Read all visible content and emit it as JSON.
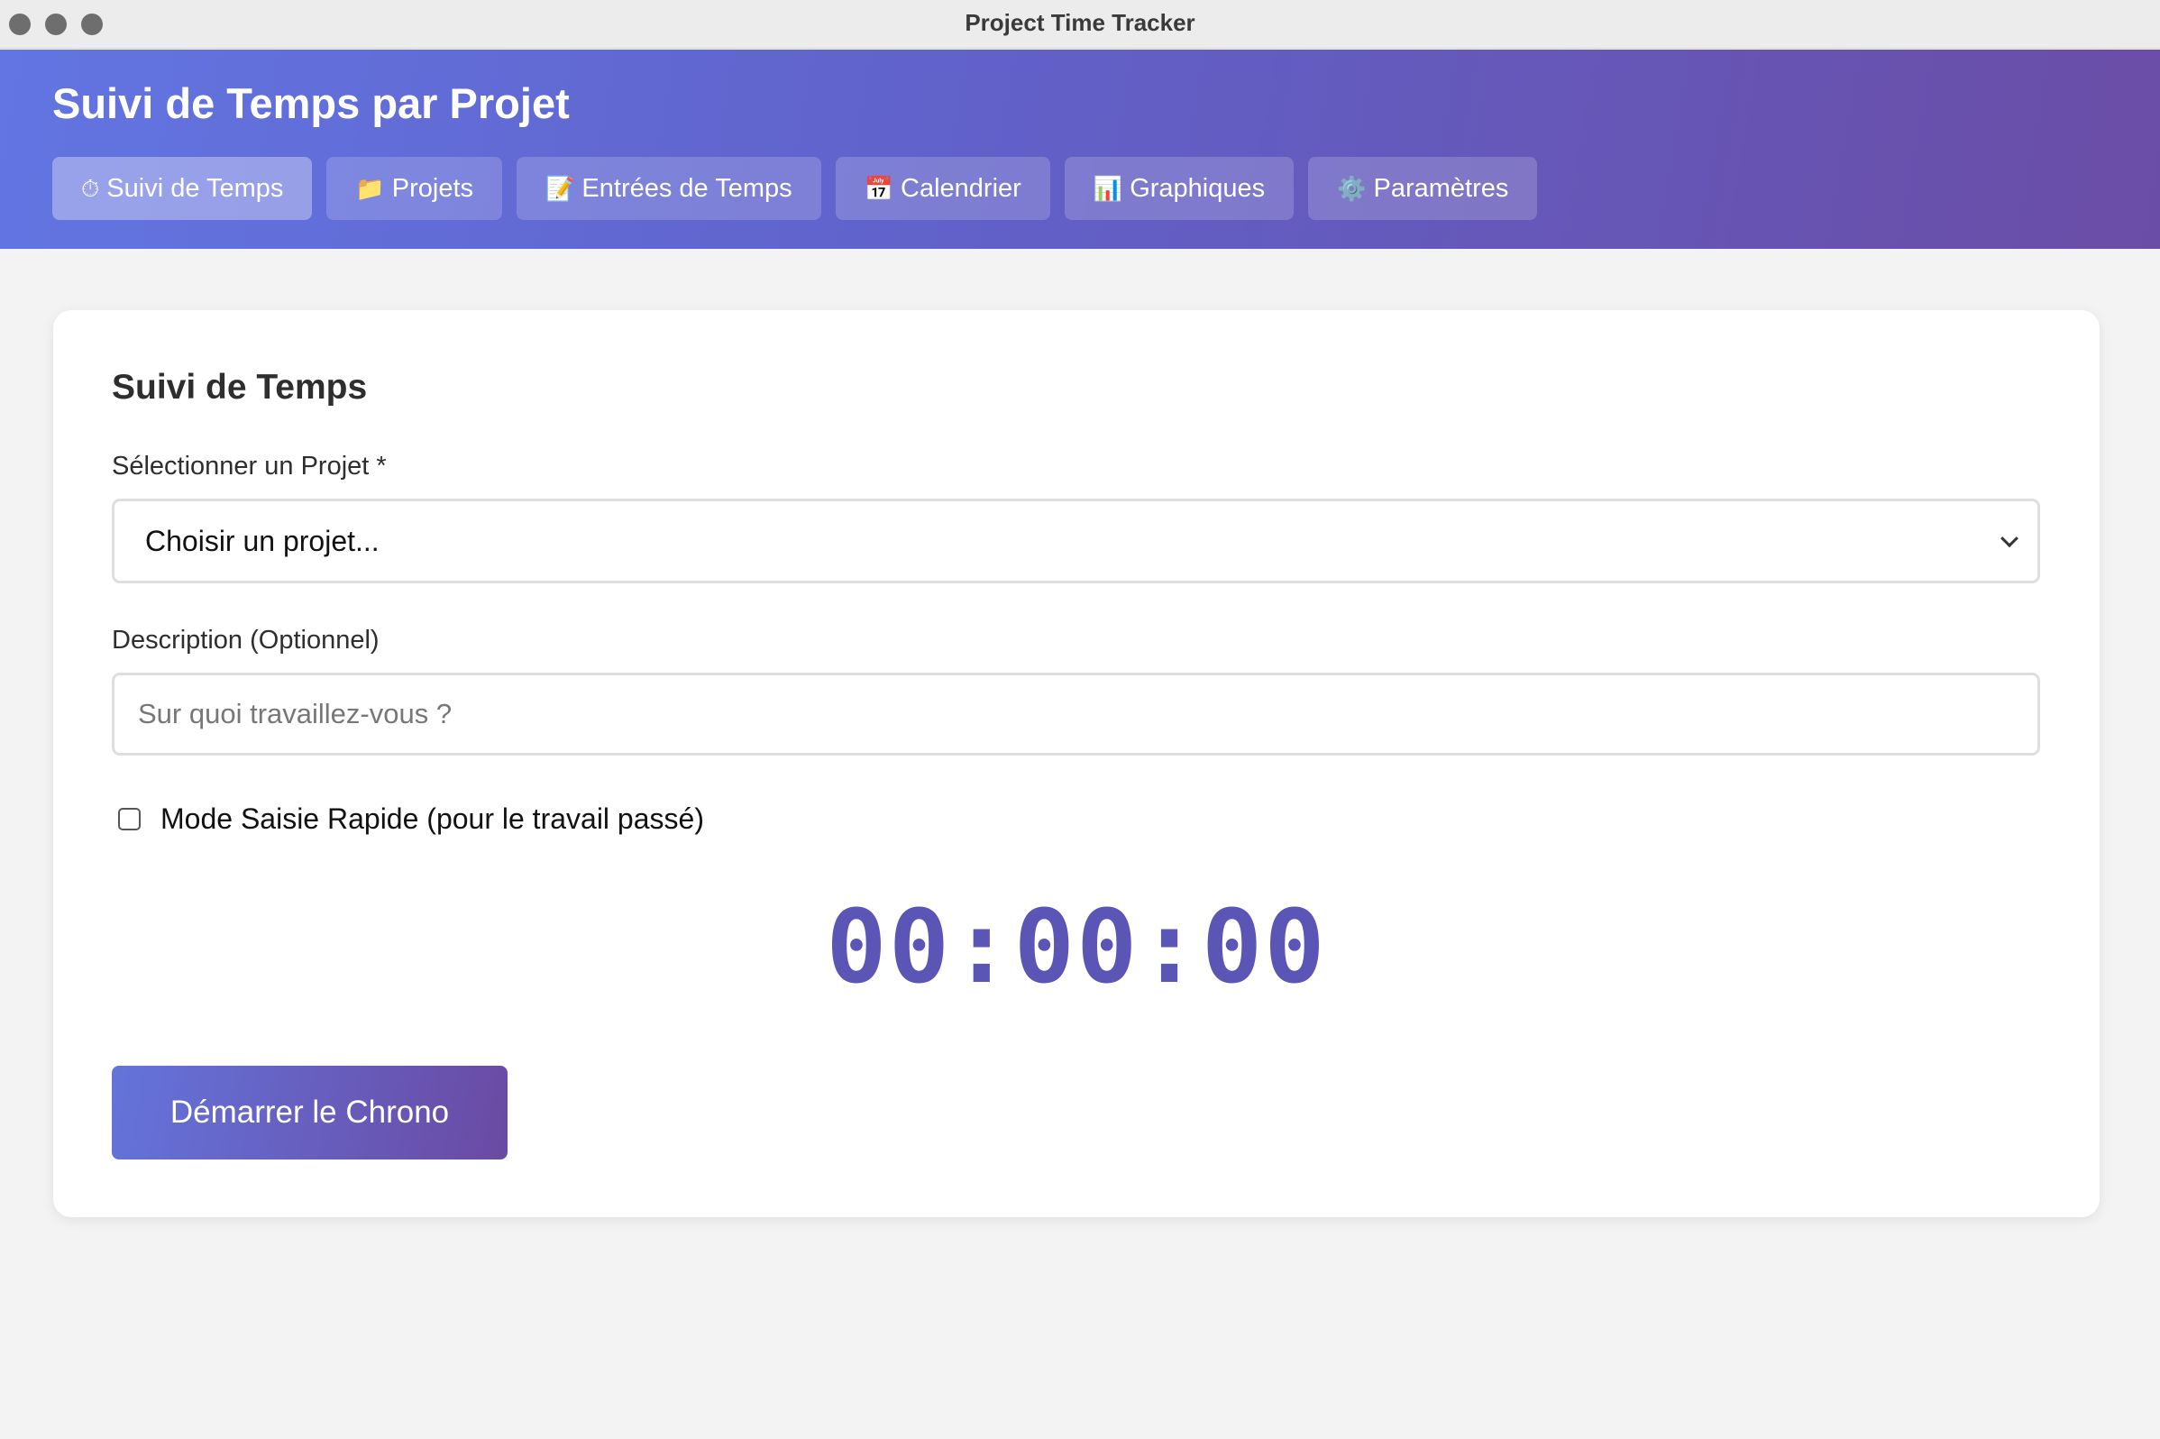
{
  "window": {
    "title": "Project Time Tracker"
  },
  "header": {
    "app_title": "Suivi de Temps par Projet",
    "tabs": [
      {
        "icon": "⏱",
        "icon_name": "stopwatch-icon",
        "label": "Suivi de Temps",
        "active": true
      },
      {
        "icon": "📁",
        "icon_name": "folder-icon",
        "label": "Projets",
        "active": false
      },
      {
        "icon": "📝",
        "icon_name": "memo-icon",
        "label": "Entrées de Temps",
        "active": false
      },
      {
        "icon": "📅",
        "icon_name": "calendar-icon",
        "label": "Calendrier",
        "active": false
      },
      {
        "icon": "📊",
        "icon_name": "bar-chart-icon",
        "label": "Graphiques",
        "active": false
      },
      {
        "icon": "⚙️",
        "icon_name": "gear-icon",
        "label": "Paramètres",
        "active": false
      }
    ]
  },
  "tracker": {
    "title": "Suivi de Temps",
    "project_label": "Sélectionner un Projet *",
    "project_selected": "Choisir un projet...",
    "description_label": "Description (Optionnel)",
    "description_placeholder": "Sur quoi travaillez-vous ?",
    "description_value": "",
    "quick_mode_label": "Mode Saisie Rapide (pour le travail passé)",
    "quick_mode_checked": false,
    "timer": "00:00:00",
    "start_label": "Démarrer le Chrono"
  },
  "colors": {
    "header_gradient_start": "#6275e2",
    "header_gradient_end": "#6a4da6",
    "timer": "#5b55b5",
    "background": "#f3f3f3"
  }
}
